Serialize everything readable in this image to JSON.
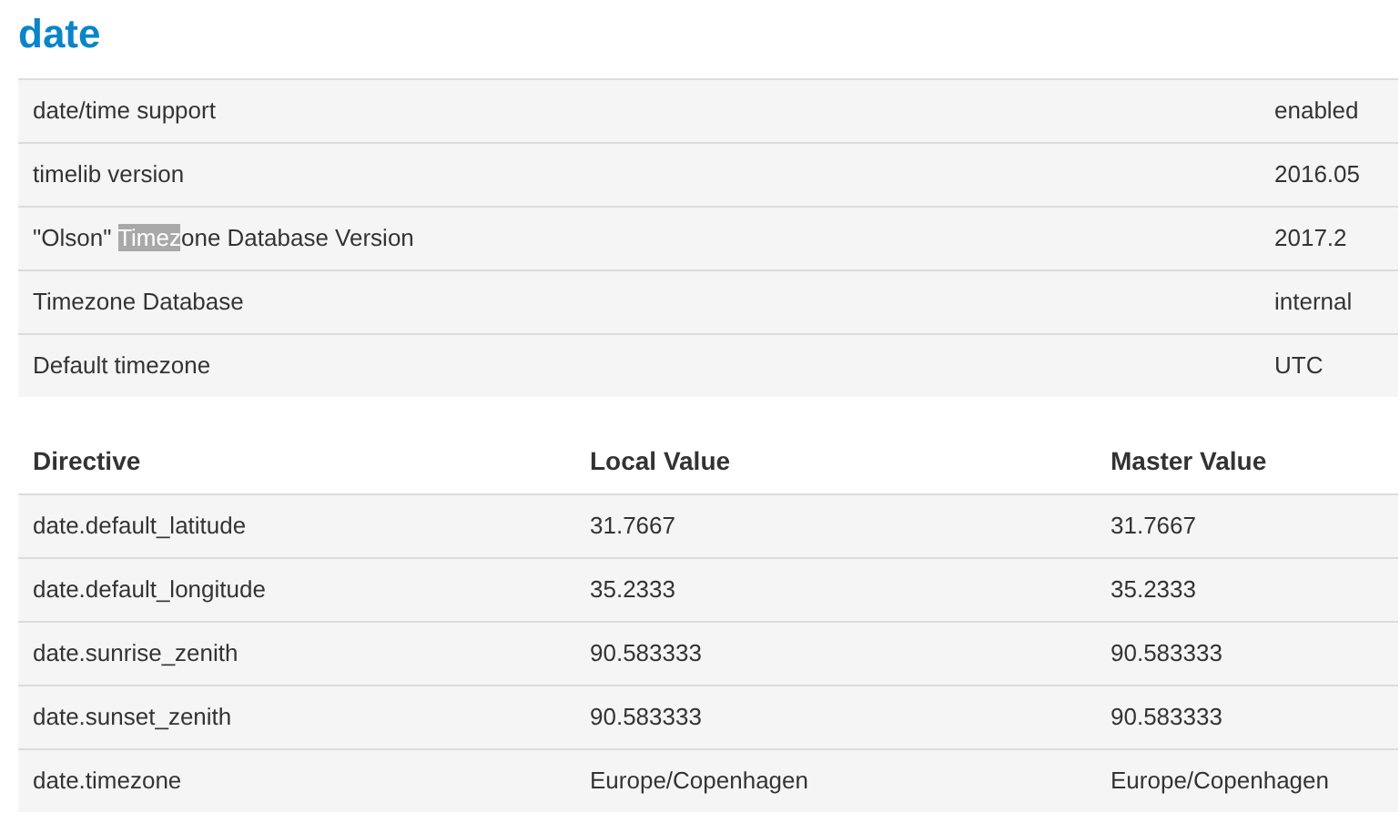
{
  "title": "date",
  "info_rows": [
    {
      "label": [
        {
          "text": "date/time support",
          "selected": false
        }
      ],
      "value": "enabled"
    },
    {
      "label": [
        {
          "text": "timelib version",
          "selected": false
        }
      ],
      "value": "2016.05"
    },
    {
      "label": [
        {
          "text": "\"Olson\" ",
          "selected": false
        },
        {
          "text": "Timez",
          "selected": true
        },
        {
          "text": "one Database Version",
          "selected": false
        }
      ],
      "value": "2017.2"
    },
    {
      "label": [
        {
          "text": "Timezone Database",
          "selected": false
        }
      ],
      "value": "internal"
    },
    {
      "label": [
        {
          "text": "Default timezone",
          "selected": false
        }
      ],
      "value": "UTC"
    }
  ],
  "directives": {
    "columns": [
      "Directive",
      "Local Value",
      "Master Value"
    ],
    "rows": [
      [
        "date.default_latitude",
        "31.7667",
        "31.7667"
      ],
      [
        "date.default_longitude",
        "35.2333",
        "35.2333"
      ],
      [
        "date.sunrise_zenith",
        "90.583333",
        "90.583333"
      ],
      [
        "date.sunset_zenith",
        "90.583333",
        "90.583333"
      ],
      [
        "date.timezone",
        "Europe/Copenhagen",
        "Europe/Copenhagen"
      ]
    ]
  }
}
